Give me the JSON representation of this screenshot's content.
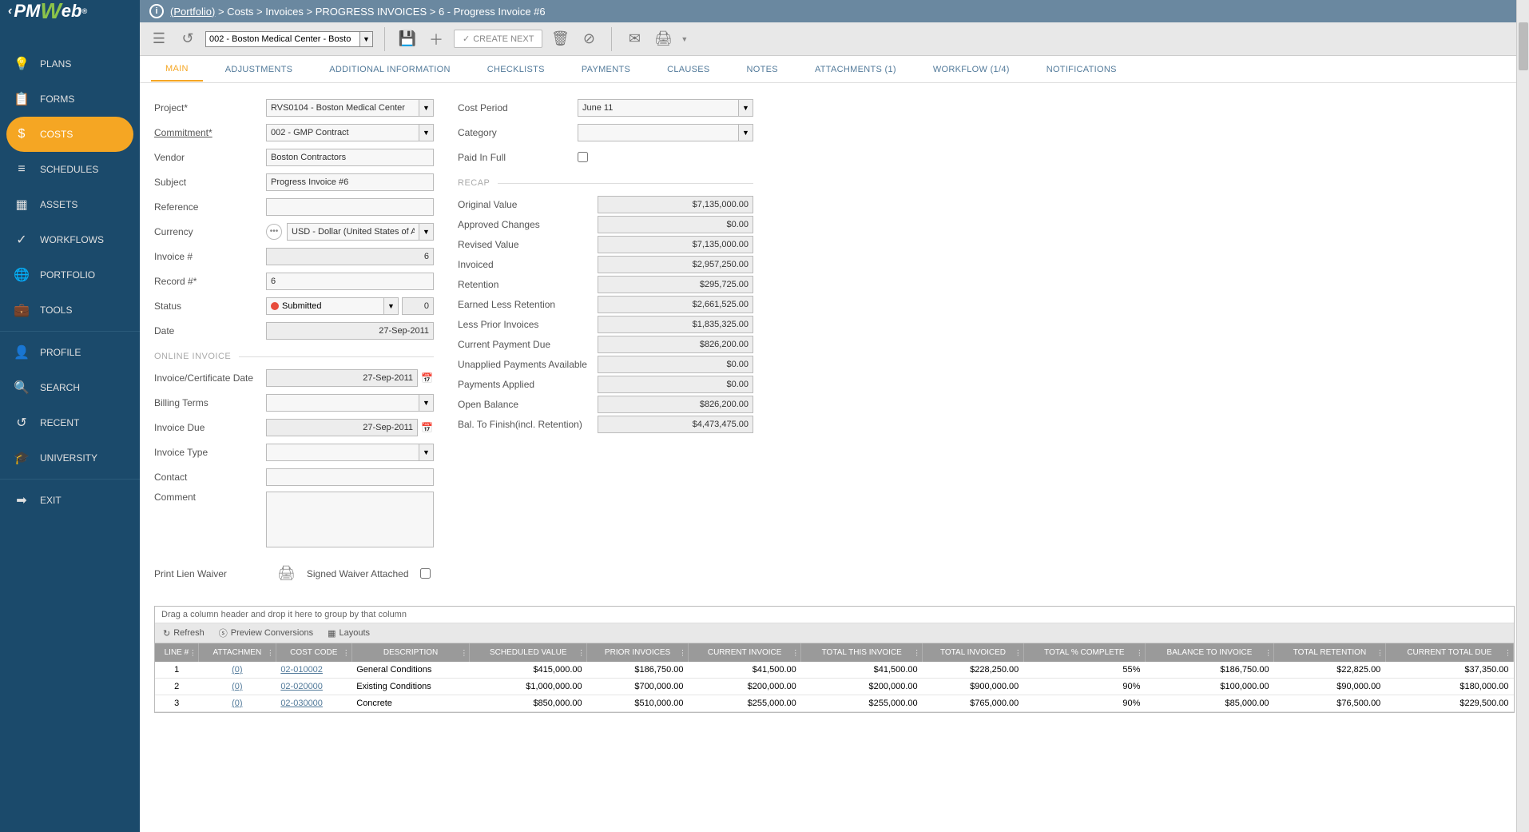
{
  "breadcrumb": {
    "root": "(Portfolio)",
    "parts": [
      "Costs",
      "Invoices",
      "PROGRESS INVOICES",
      "6 - Progress Invoice #6"
    ]
  },
  "toolbar": {
    "record_select": "002 - Boston Medical Center - Bosto",
    "create_next": "CREATE NEXT"
  },
  "sidebar": {
    "items": [
      {
        "icon": "💡",
        "label": "PLANS"
      },
      {
        "icon": "📋",
        "label": "FORMS"
      },
      {
        "icon": "$",
        "label": "COSTS",
        "active": true
      },
      {
        "icon": "≡",
        "label": "SCHEDULES"
      },
      {
        "icon": "▦",
        "label": "ASSETS"
      },
      {
        "icon": "✓",
        "label": "WORKFLOWS"
      },
      {
        "icon": "🌐",
        "label": "PORTFOLIO"
      },
      {
        "icon": "💼",
        "label": "TOOLS"
      }
    ],
    "items2": [
      {
        "icon": "👤",
        "label": "PROFILE"
      },
      {
        "icon": "🔍",
        "label": "SEARCH"
      },
      {
        "icon": "↺",
        "label": "RECENT"
      },
      {
        "icon": "🎓",
        "label": "UNIVERSITY"
      }
    ],
    "items3": [
      {
        "icon": "➡",
        "label": "EXIT"
      }
    ]
  },
  "tabs": [
    "MAIN",
    "ADJUSTMENTS",
    "ADDITIONAL INFORMATION",
    "CHECKLISTS",
    "PAYMENTS",
    "CLAUSES",
    "NOTES",
    "ATTACHMENTS (1)",
    "WORKFLOW (1/4)",
    "NOTIFICATIONS"
  ],
  "form": {
    "project_label": "Project*",
    "project": "RVS0104 - Boston Medical Center",
    "commitment_label": "Commitment*",
    "commitment": "002 - GMP Contract",
    "vendor_label": "Vendor",
    "vendor": "Boston Contractors",
    "subject_label": "Subject",
    "subject": "Progress Invoice #6",
    "reference_label": "Reference",
    "reference": "",
    "currency_label": "Currency",
    "currency": "USD - Dollar (United States of America)",
    "invoice_num_label": "Invoice #",
    "invoice_num": "6",
    "record_num_label": "Record #*",
    "record_num": "6",
    "status_label": "Status",
    "status": "Submitted",
    "status_num": "0",
    "date_label": "Date",
    "date": "27-Sep-2011",
    "online_invoice_section": "ONLINE INVOICE",
    "cert_date_label": "Invoice/Certificate Date",
    "cert_date": "27-Sep-2011",
    "billing_terms_label": "Billing Terms",
    "billing_terms": "",
    "invoice_due_label": "Invoice Due",
    "invoice_due": "27-Sep-2011",
    "invoice_type_label": "Invoice Type",
    "invoice_type": "",
    "contact_label": "Contact",
    "contact": "",
    "comment_label": "Comment",
    "comment": "",
    "lien_label": "Print Lien Waiver",
    "waiver_label": "Signed Waiver Attached",
    "cost_period_label": "Cost Period",
    "cost_period": "June 11",
    "category_label": "Category",
    "category": "",
    "paid_full_label": "Paid In Full",
    "recap_section": "RECAP",
    "recap": [
      {
        "label": "Original Value",
        "value": "$7,135,000.00"
      },
      {
        "label": "Approved Changes",
        "value": "$0.00"
      },
      {
        "label": "Revised Value",
        "value": "$7,135,000.00"
      },
      {
        "label": "Invoiced",
        "value": "$2,957,250.00"
      },
      {
        "label": "Retention",
        "value": "$295,725.00"
      },
      {
        "label": "Earned Less Retention",
        "value": "$2,661,525.00"
      },
      {
        "label": "Less Prior Invoices",
        "value": "$1,835,325.00"
      },
      {
        "label": "Current Payment Due",
        "value": "$826,200.00"
      },
      {
        "label": "Unapplied Payments Available",
        "value": "$0.00"
      },
      {
        "label": "Payments Applied",
        "value": "$0.00"
      },
      {
        "label": "Open Balance",
        "value": "$826,200.00"
      },
      {
        "label": "Bal. To Finish(incl. Retention)",
        "value": "$4,473,475.00"
      }
    ]
  },
  "grid": {
    "group_hint": "Drag a column header and drop it here to group by that column",
    "refresh": "Refresh",
    "preview": "Preview Conversions",
    "layouts": "Layouts",
    "headers": [
      "LINE #",
      "ATTACHMEN",
      "COST CODE",
      "DESCRIPTION",
      "SCHEDULED VALUE",
      "PRIOR INVOICES",
      "CURRENT INVOICE",
      "TOTAL THIS INVOICE",
      "TOTAL INVOICED",
      "TOTAL % COMPLETE",
      "BALANCE TO INVOICE",
      "TOTAL RETENTION",
      "CURRENT TOTAL DUE"
    ],
    "rows": [
      {
        "line": "1",
        "att": "(0)",
        "code": "02-010002",
        "desc": "General Conditions",
        "sched": "$415,000.00",
        "prior": "$186,750.00",
        "curr": "$41,500.00",
        "tthis": "$41,500.00",
        "tinv": "$228,250.00",
        "pct": "55%",
        "bal": "$186,750.00",
        "ret": "$22,825.00",
        "due": "$37,350.00"
      },
      {
        "line": "2",
        "att": "(0)",
        "code": "02-020000",
        "desc": "Existing Conditions",
        "sched": "$1,000,000.00",
        "prior": "$700,000.00",
        "curr": "$200,000.00",
        "tthis": "$200,000.00",
        "tinv": "$900,000.00",
        "pct": "90%",
        "bal": "$100,000.00",
        "ret": "$90,000.00",
        "due": "$180,000.00"
      },
      {
        "line": "3",
        "att": "(0)",
        "code": "02-030000",
        "desc": "Concrete",
        "sched": "$850,000.00",
        "prior": "$510,000.00",
        "curr": "$255,000.00",
        "tthis": "$255,000.00",
        "tinv": "$765,000.00",
        "pct": "90%",
        "bal": "$85,000.00",
        "ret": "$76,500.00",
        "due": "$229,500.00"
      }
    ]
  }
}
